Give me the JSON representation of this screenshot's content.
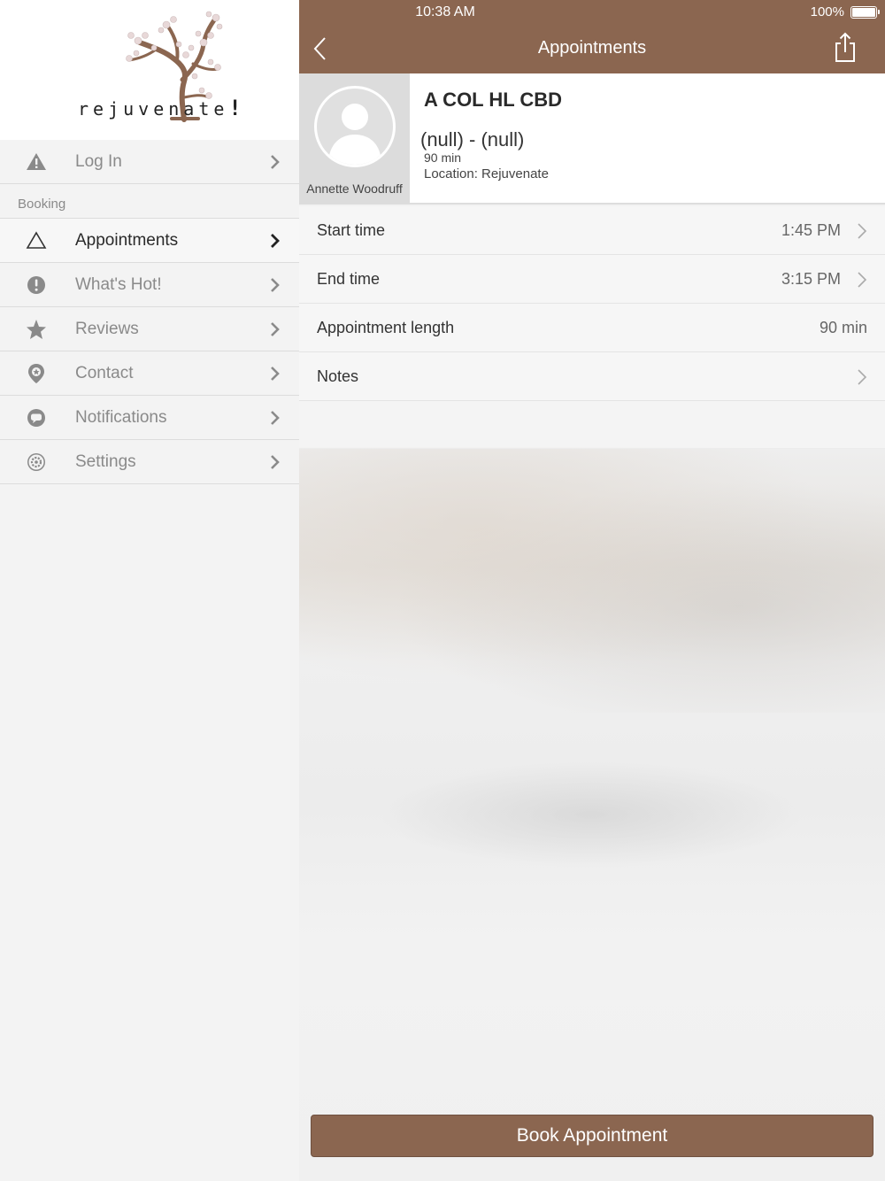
{
  "status_bar": {
    "time": "10:38 AM",
    "battery": "100%"
  },
  "sidebar": {
    "logo_text": "rejuvenate",
    "logo_bang": "!",
    "section_booking": "Booking",
    "items": [
      {
        "label": "Log In",
        "icon": "warning-icon"
      },
      {
        "label": "Appointments",
        "icon": "triangle-outline-icon"
      },
      {
        "label": "What's Hot!",
        "icon": "exclamation-circle-icon"
      },
      {
        "label": "Reviews",
        "icon": "star-icon"
      },
      {
        "label": "Contact",
        "icon": "location-pin-icon"
      },
      {
        "label": "Notifications",
        "icon": "chat-bubble-icon"
      },
      {
        "label": "Settings",
        "icon": "gear-icon"
      }
    ]
  },
  "navbar": {
    "title": "Appointments",
    "back_icon": "chevron-left-icon",
    "share_icon": "share-icon"
  },
  "appointment": {
    "provider_name": "Annette Woodruff",
    "service_name": "A COL HL CBD",
    "time_range": "(null) - (null)",
    "duration": "90 min",
    "location": "Location: Rejuvenate"
  },
  "details": {
    "start_time_label": "Start time",
    "start_time_value": "1:45 PM",
    "end_time_label": "End time",
    "end_time_value": "3:15 PM",
    "length_label": "Appointment length",
    "length_value": "90 min",
    "notes_label": "Notes"
  },
  "book_button": "Book Appointment",
  "colors": {
    "brand": "#8b6650",
    "sidebar_bg": "#f3f3f3"
  }
}
